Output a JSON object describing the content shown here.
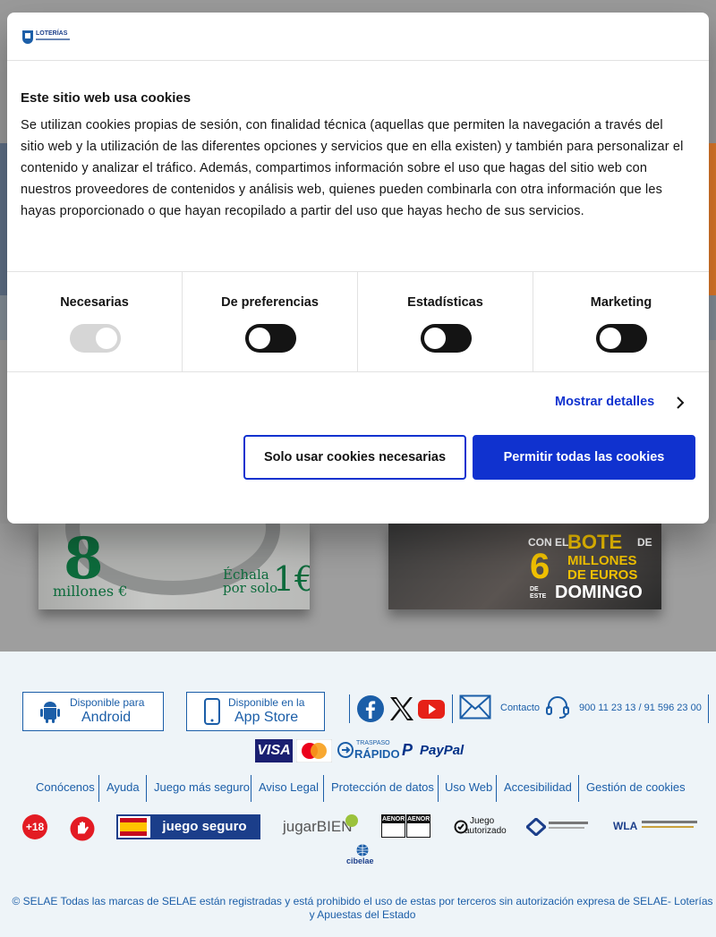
{
  "cookie_dialog": {
    "logo_text": "LOTERÍAS",
    "title": "Este sitio web usa cookies",
    "body": "Se utilizan cookies propias de sesión, con finalidad técnica (aquellas que permiten  la navegación a través del sitio web y la utilización de las diferentes opciones y servicios que en ella existen) y también para personalizar el contenido y analizar el tráfico. Además, compartimos información sobre el uso que hagas del sitio web con nuestros proveedores de contenidos y análisis web, quienes pueden combinarla con otra información que les hayas proporcionado o que hayan recopilado a partir del uso que hayas hecho de sus servicios.",
    "categories": [
      {
        "label": "Necesarias",
        "enabled": true,
        "locked": true
      },
      {
        "label": "De preferencias",
        "enabled": false,
        "locked": false
      },
      {
        "label": "Estadísticas",
        "enabled": false,
        "locked": false
      },
      {
        "label": "Marketing",
        "enabled": false,
        "locked": false
      }
    ],
    "show_details": "Mostrar detalles",
    "btn_necessary": "Solo usar cookies necesarias",
    "btn_allow_all": "Permitir todas las cookies",
    "accent_color": "#1032cf"
  },
  "promos": {
    "left": {
      "number": "8",
      "millions": "millones €",
      "echala": "Échala",
      "por_solo": "por solo",
      "price": "1€"
    },
    "right": {
      "con_el": "CON EL",
      "bote": "BOTE",
      "de": "DE",
      "six": "6",
      "millones": "MILLONES",
      "de_euros": "DE EUROS",
      "de_este": "DE ESTE",
      "domingo": "DOMINGO"
    }
  },
  "footer": {
    "android_top": "Disponible para",
    "android_main": "Android",
    "ios_top": "Disponible en la",
    "ios_main": "App Store",
    "contact": "Contacto",
    "phones": "900 11 23 13 / 91 596 23 00",
    "payments": {
      "visa": "VISA",
      "traspaso_top": "TRASPASO",
      "traspaso_main": "RÁPIDO",
      "paypal": "PayPal"
    },
    "links": [
      "Conócenos",
      "Ayuda",
      "Juego más seguro",
      "Aviso Legal",
      "Protección de datos",
      "Uso Web",
      "Accesibilidad",
      "Gestión de cookies"
    ],
    "badges": {
      "plus18": "+18",
      "juego_seguro": "juego seguro",
      "jugarbien": "jugarBIEN",
      "aenor": "AENOR",
      "juego_autorizado_top": "Juego",
      "juego_autorizado_main": "autorizado",
      "wla": "WLA",
      "cibelae": "cibelae"
    },
    "copyright": "© SELAE Todas las marcas de SELAE están registradas y está prohibido el uso de estas por terceros sin autorización expresa de SELAE- Loterías y Apuestas del Estado",
    "link_color": "#1b5ea8"
  }
}
